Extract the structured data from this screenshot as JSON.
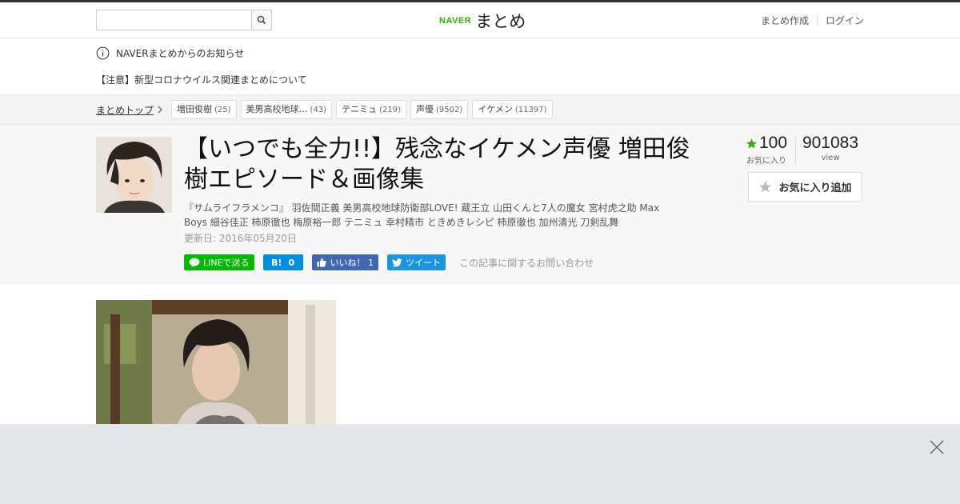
{
  "header": {
    "search_placeholder": "",
    "logo_naver": "NAVER",
    "logo_matome": "まとめ",
    "links": [
      "まとめ作成",
      "ログイン"
    ]
  },
  "notice": {
    "title": "NAVERまとめからのお知らせ",
    "item": "【注意】新型コロナウイルス関連まとめについて"
  },
  "breadcrumb": {
    "top": "まとめトップ",
    "tags": [
      {
        "label": "増田俊樹",
        "count": "(25)"
      },
      {
        "label": "美男高校地球…",
        "count": "(43)"
      },
      {
        "label": "テニミュ",
        "count": "(219)"
      },
      {
        "label": "声優",
        "count": "(9502)"
      },
      {
        "label": "イケメン",
        "count": "(11397)"
      }
    ]
  },
  "article": {
    "title": "【いつでも全力!!】残念なイケメン声優 増田俊樹エピソード＆画像集",
    "description": "『サムライフラメンコ』 羽佐間正義 美男高校地球防衛部LOVE! 蔵王立 山田くんと7人の魔女 宮村虎之助 Max Boys 細谷佳正 柿原徹也 梅原裕一郎 テニミュ 幸村精市 ときめきレシピ 柿原徹也 加州清光 刀剣乱舞",
    "updated": "更新日: 2016年05月20日",
    "favorites": "100",
    "favorites_label": "お気に入り",
    "views": "901083",
    "views_label": "view",
    "fav_button": "お気に入り追加",
    "share": {
      "line": "LINEで送る",
      "hatena_count": "0",
      "facebook": "いいね！ 1",
      "twitter": "ツイート",
      "contact": "この記事に関するお問い合わせ"
    }
  },
  "colors": {
    "naver_green": "#2db400",
    "line": "#00b900",
    "hatena": "#008fde",
    "facebook": "#4267b2",
    "twitter": "#1b95e0",
    "ad_bg": "#e2e6e9"
  }
}
